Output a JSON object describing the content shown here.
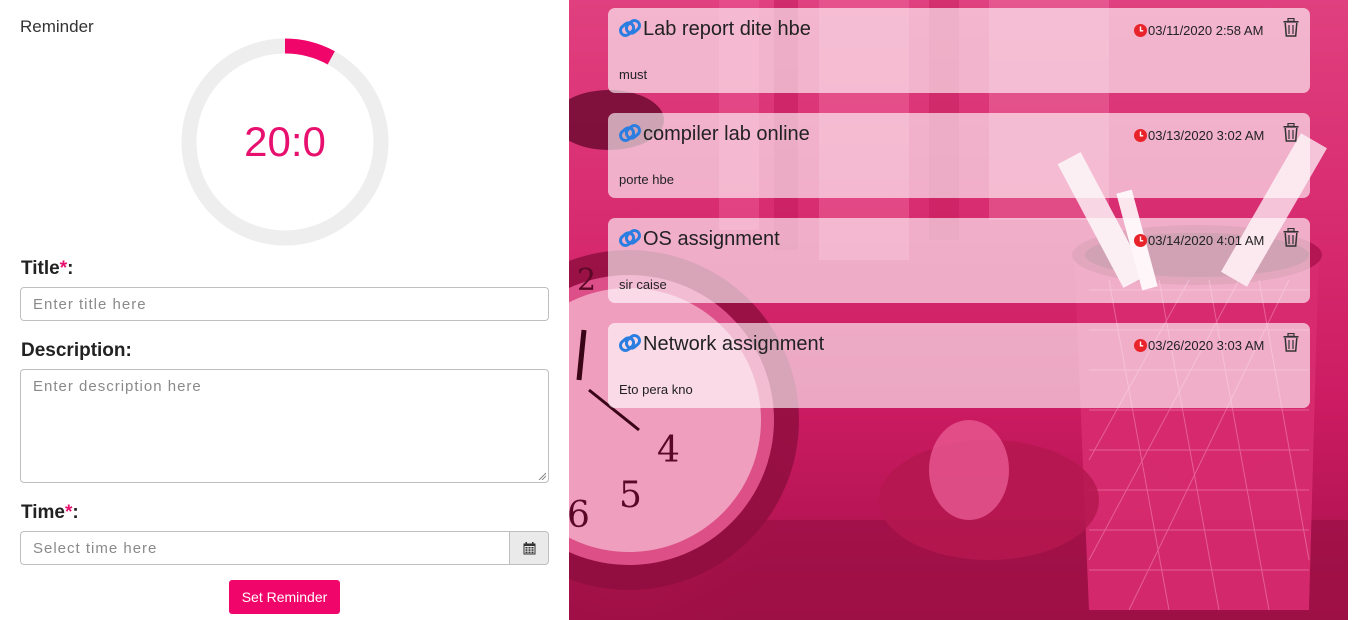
{
  "app_title": "Reminder",
  "timer": {
    "display": "20:0",
    "progress_fraction": 0.08,
    "accent": "#e8106e"
  },
  "form": {
    "title_label": "Title",
    "description_label": "Description:",
    "time_label": "Time",
    "required_mark": "*",
    "label_colon": ":",
    "title_placeholder": "Enter title here",
    "description_placeholder": "Enter description here",
    "time_placeholder": "Select time here",
    "calendar_icon": "calendar-icon",
    "submit_label": "Set Reminder"
  },
  "reminders": [
    {
      "title": "Lab report dite hbe",
      "datetime": "03/11/2020 2:58 AM",
      "description": "must"
    },
    {
      "title": "compiler lab online",
      "datetime": "03/13/2020 3:02 AM",
      "description": "porte hbe"
    },
    {
      "title": "OS assignment",
      "datetime": "03/14/2020 4:01 AM",
      "description": "sir caise"
    },
    {
      "title": "Network assignment",
      "datetime": "03/26/2020 3:03 AM",
      "description": "Eto pera kno"
    }
  ],
  "icons": {
    "reminder": "attachment-icon",
    "time": "clock-icon",
    "delete": "trash-icon"
  },
  "colors": {
    "brand": "#f0066a",
    "icon_blue": "#2a7de1",
    "clock_red": "#e8232a"
  }
}
